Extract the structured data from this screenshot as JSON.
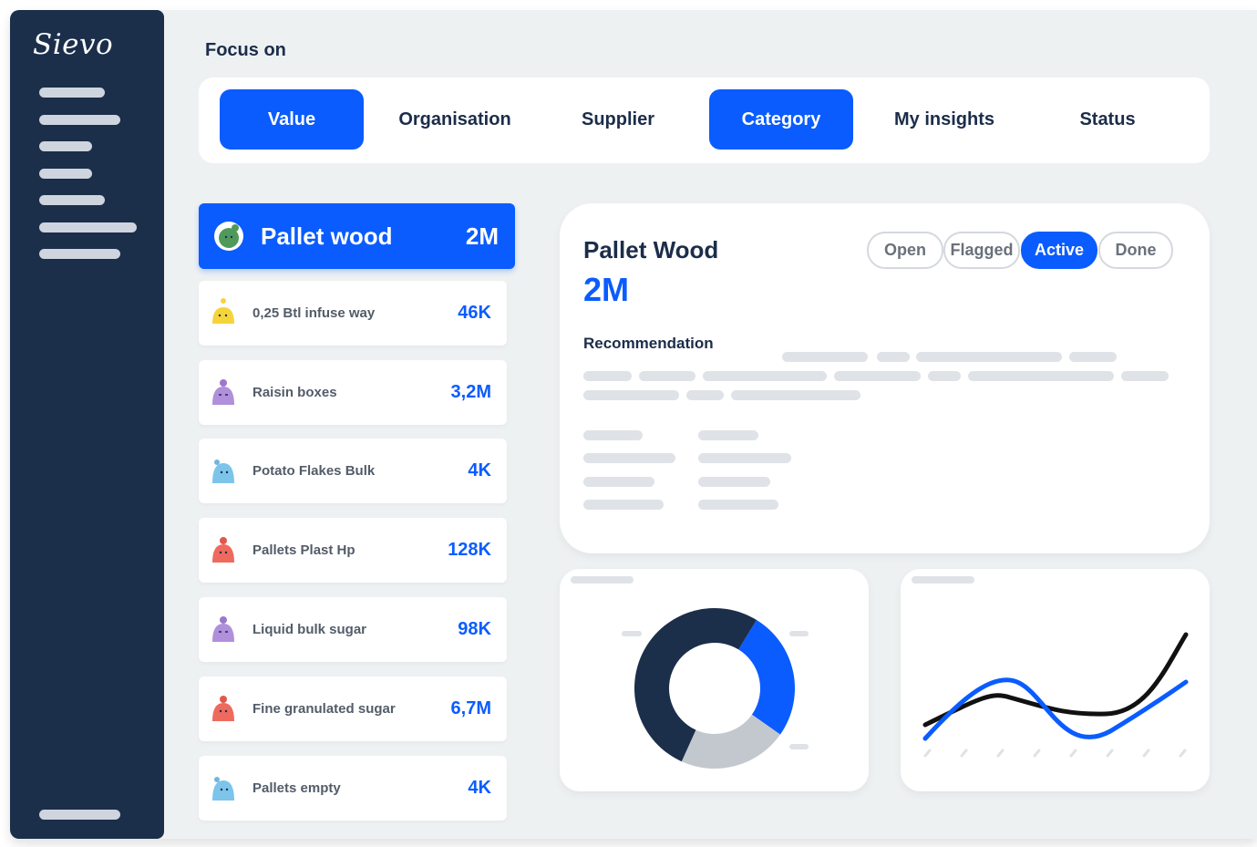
{
  "app": {
    "logo_text": "Sievo"
  },
  "focus": {
    "title": "Focus on",
    "tabs": [
      {
        "label": "Value",
        "active": true
      },
      {
        "label": "Organisation",
        "active": false
      },
      {
        "label": "Supplier",
        "active": false
      },
      {
        "label": "Category",
        "active": true
      },
      {
        "label": "My insights",
        "active": false
      },
      {
        "label": "Status",
        "active": false
      }
    ]
  },
  "selected_category": {
    "name": "Pallet wood",
    "value": "2M",
    "avatar": "green-character"
  },
  "categories": [
    {
      "name": "0,25 Btl infuse way",
      "value": "46K",
      "avatar": "yellow-character"
    },
    {
      "name": "Raisin boxes",
      "value": "3,2M",
      "avatar": "purple-character"
    },
    {
      "name": "Potato Flakes Bulk",
      "value": "4K",
      "avatar": "blue-character"
    },
    {
      "name": "Pallets Plast Hp",
      "value": "128K",
      "avatar": "red-character"
    },
    {
      "name": "Liquid bulk sugar",
      "value": "98K",
      "avatar": "purple-character"
    },
    {
      "name": "Fine granulated sugar",
      "value": "6,7M",
      "avatar": "red-character"
    },
    {
      "name": "Pallets empty",
      "value": "4K",
      "avatar": "blue-character"
    }
  ],
  "detail": {
    "title": "Pallet Wood",
    "value": "2M",
    "status_pills": [
      {
        "label": "Open",
        "active": false
      },
      {
        "label": "Flagged",
        "active": false
      },
      {
        "label": "Active",
        "active": true
      },
      {
        "label": "Done",
        "active": false
      }
    ],
    "recommendation_label": "Recommendation"
  },
  "colors": {
    "brand_blue": "#0a5cff",
    "sidebar_navy": "#1b2e4a",
    "background": "#eef1f2",
    "donut_grey": "#c3c7ce"
  },
  "charts": {
    "donut": {
      "segments": [
        {
          "color": "#0a5cff",
          "share": 0.26
        },
        {
          "color": "#c3c7ce",
          "share": 0.22
        },
        {
          "color": "#1b2e4a",
          "share": 0.52
        }
      ]
    },
    "line": {
      "series": [
        {
          "color": "#111111"
        },
        {
          "color": "#0a5cff"
        }
      ]
    }
  }
}
